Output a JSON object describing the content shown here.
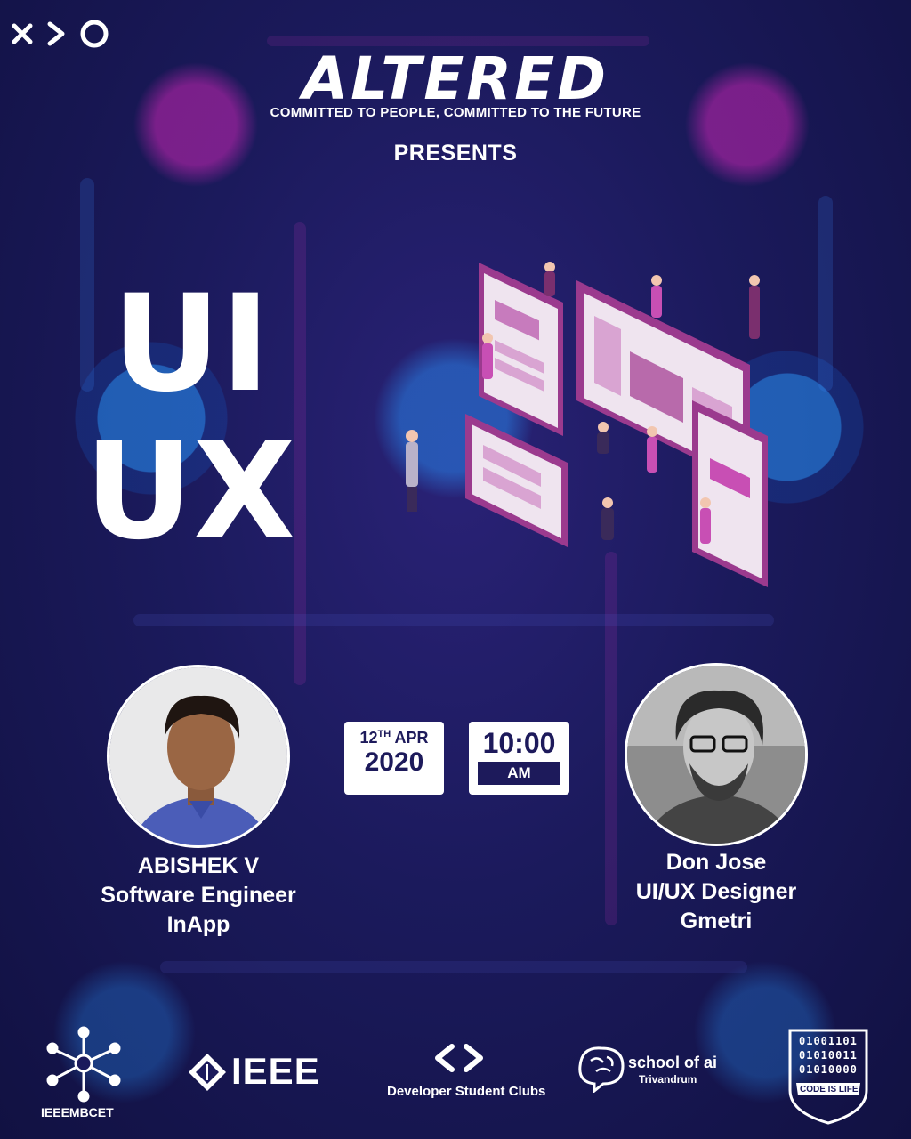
{
  "branding": {
    "brand_logo_icon": "xo-arrow-logo-icon",
    "event_title": "ALTERED",
    "tagline": "COMMITTED TO PEOPLE, COMMITTED TO THE FUTURE",
    "presents": "PRESENTS"
  },
  "topic": {
    "line1": "UI",
    "line2": "UX",
    "illustration_icon": "ui-ux-team-illustration"
  },
  "schedule": {
    "day": "12",
    "day_suffix": "TH",
    "month": "APR",
    "year": "2020",
    "time": "10:00",
    "meridiem": "AM"
  },
  "speakers": [
    {
      "name": "ABISHEK V",
      "role": "Software Engineer",
      "company": "InApp"
    },
    {
      "name": "Don Jose",
      "role": "UI/UX Designer",
      "company": "Gmetri"
    }
  ],
  "sponsors": {
    "ieee_mbcet": "IEEEMBCET",
    "ieee": "IEEE",
    "dsc": "Developer Student Clubs",
    "school_of_ai": "school of ai",
    "school_of_ai_city": "Trivandrum",
    "code_is_life": "CODE IS LIFE",
    "binary_lines": [
      "01001101",
      "01010011",
      "01010000"
    ]
  },
  "colors": {
    "background": "#1b1a5c",
    "accent_pink": "#c84fb4",
    "accent_blue": "#2b8cff",
    "text": "#ffffff"
  }
}
